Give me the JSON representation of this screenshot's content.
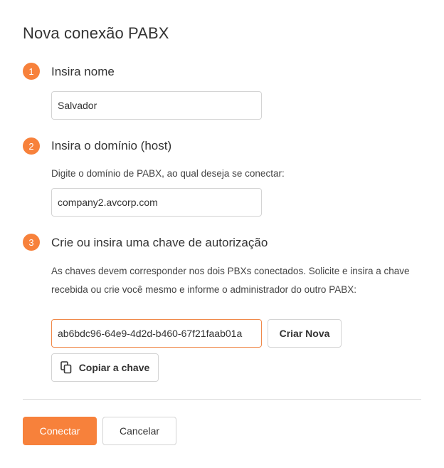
{
  "dialog": {
    "title": "Nova conexão PABX"
  },
  "steps": [
    {
      "number": "1",
      "heading": "Insira nome"
    },
    {
      "number": "2",
      "heading": "Insira o domínio (host)"
    },
    {
      "number": "3",
      "heading": "Crie ou insira uma chave de autorização"
    }
  ],
  "name_field": {
    "value": "Salvador"
  },
  "domain": {
    "help": "Digite o domínio de PABX, ao qual deseja se conectar:",
    "value": "company2.avcorp.com"
  },
  "key": {
    "help_line1": "As chaves devem corresponder nos dois PBXs conectados. Solicite e insira a chave",
    "help_line2": "recebida ou crie você mesmo e informe o administrador do outro PABX:",
    "value": "ab6bdc96-64e9-4d2d-b460-67f21faab01a",
    "create_label": "Criar Nova",
    "copy_label": "Copiar a chave",
    "copy_icon": "copy-icon"
  },
  "footer": {
    "connect_label": "Conectar",
    "cancel_label": "Cancelar"
  },
  "colors": {
    "accent": "#f7813b",
    "border": "#d4d4d4",
    "text": "#333333"
  }
}
